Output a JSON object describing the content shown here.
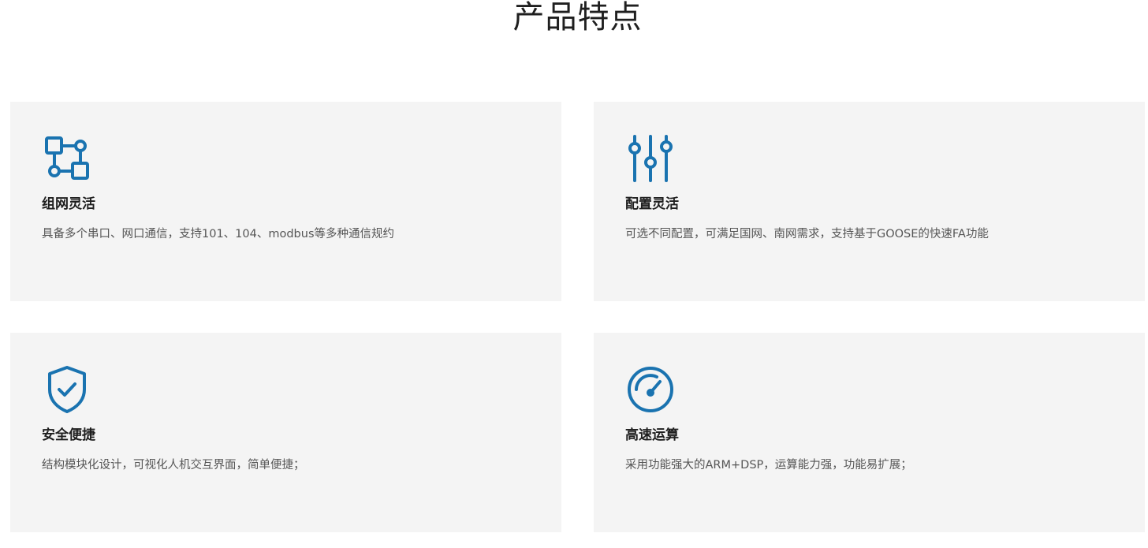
{
  "section": {
    "title": "产品特点"
  },
  "colors": {
    "icon": "#1a73b0",
    "card_bg": "#f4f4f4"
  },
  "features": [
    {
      "icon": "network-nodes-icon",
      "title": "组网灵活",
      "desc": "具备多个串口、网口通信，支持101、104、modbus等多种通信规约"
    },
    {
      "icon": "sliders-icon",
      "title": "配置灵活",
      "desc": "可选不同配置，可满足国网、南网需求，支持基于GOOSE的快速FA功能"
    },
    {
      "icon": "shield-check-icon",
      "title": "安全便捷",
      "desc": "结构模块化设计，可视化人机交互界面，简单便捷；"
    },
    {
      "icon": "speedometer-icon",
      "title": "高速运算",
      "desc": "采用功能强大的ARM+DSP，运算能力强，功能易扩展；"
    }
  ]
}
